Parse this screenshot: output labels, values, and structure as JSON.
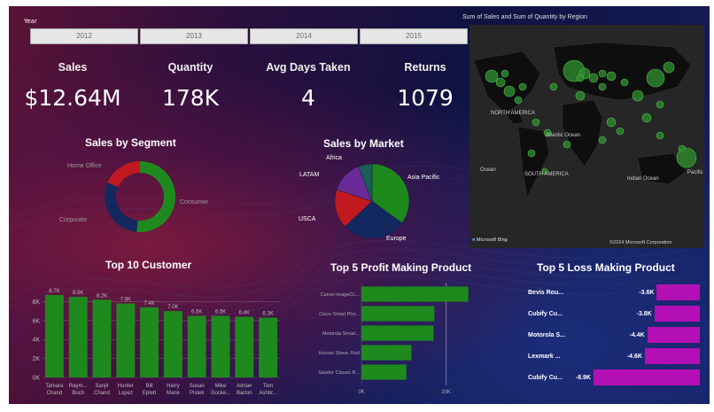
{
  "slicer": {
    "title": "Year",
    "years": [
      "2012",
      "2013",
      "2014",
      "2015"
    ]
  },
  "kpis": [
    {
      "label": "Sales",
      "value": "$12.64M"
    },
    {
      "label": "Quantity",
      "value": "178K"
    },
    {
      "label": "Avg Days Taken",
      "value": "4"
    },
    {
      "label": "Returns",
      "value": "1079"
    }
  ],
  "segment_chart": {
    "title": "Sales by Segment",
    "labels": [
      "Home Office",
      "Consumer",
      "Corporate"
    ]
  },
  "market_chart": {
    "title": "Sales by Market",
    "labels": [
      "Africa",
      "Asia Pacific",
      "Europe",
      "USCA",
      "LATAM"
    ]
  },
  "map": {
    "title": "Sum of Sales and Sum of Quantity by Region",
    "labels": [
      "NORTH AMERICA",
      "Atlantic Ocean",
      "SOUTH AMERICA",
      "Indian Ocean",
      "Ocean",
      "Pacific"
    ],
    "brand": "Microsoft Bing",
    "copyright": "©2024 Microsoft Corporation"
  },
  "customer_chart": {
    "title": "Top 10 Customer"
  },
  "profit_chart": {
    "title": "Top 5 Profit Making Product"
  },
  "loss_chart": {
    "title": "Top 5 Loss Making Product"
  },
  "colors": {
    "green": "#1e8a1e",
    "navy": "#12285e",
    "red": "#c0191f",
    "purple": "#6a2a98",
    "teal": "#1a5e58",
    "magenta": "#b40fb4"
  },
  "chart_data": [
    {
      "type": "pie",
      "title": "Sales by Segment",
      "donut": true,
      "categories": [
        "Consumer",
        "Corporate",
        "Home Office"
      ],
      "values": [
        51.5,
        30.1,
        18.4
      ]
    },
    {
      "type": "pie",
      "title": "Sales by Market",
      "categories": [
        "Asia Pacific",
        "Europe",
        "USCA",
        "LATAM",
        "Africa"
      ],
      "values": [
        35,
        28,
        17,
        14,
        6
      ]
    },
    {
      "type": "bar",
      "title": "Top 10 Customer",
      "categories": [
        "Tamara Chand",
        "Raym... Buch",
        "Sanjit Chand",
        "Hunter Lopez",
        "Bill Eplett",
        "Harry Marie",
        "Susan Pistek",
        "Mike Gocke...",
        "Adrian Barton",
        "Tom Ashbr..."
      ],
      "values": [
        8.7,
        8.5,
        8.2,
        7.8,
        7.4,
        7.0,
        6.5,
        6.5,
        6.4,
        6.3
      ],
      "data_labels": [
        "8.7K",
        "8.5K",
        "8.2K",
        "7.8K",
        "7.4K",
        "7.0K",
        "6.5K",
        "6.5K",
        "6.4K",
        "6.3K"
      ],
      "yticks": [
        "0K",
        "2K",
        "4K",
        "6K",
        "8K"
      ],
      "ylim": [
        0,
        10
      ]
    },
    {
      "type": "bar",
      "orientation": "horizontal",
      "title": "Top 5 Profit Making Product",
      "categories": [
        "Canon imageCL...",
        "Cisco Smart Pho...",
        "Motorola Smart...",
        "Hoover Stove, Red",
        "Sauder Classic B..."
      ],
      "values": [
        25.2,
        17.2,
        17.0,
        11.8,
        10.6
      ],
      "xticks": [
        "0K",
        "20K"
      ],
      "xlim": [
        0,
        28
      ]
    },
    {
      "type": "bar",
      "orientation": "horizontal",
      "title": "Top 5 Loss Making Product",
      "categories": [
        "Bevis Rou...",
        "Cubify Cu...",
        "Motorola S...",
        "Lexmark ...",
        "Cubify Cu..."
      ],
      "values": [
        -3.6,
        -3.8,
        -4.4,
        -4.6,
        -8.9
      ],
      "data_labels": [
        "-3.6K",
        "-3.8K",
        "-4.4K",
        "-4.6K",
        "-8.9K"
      ]
    }
  ]
}
